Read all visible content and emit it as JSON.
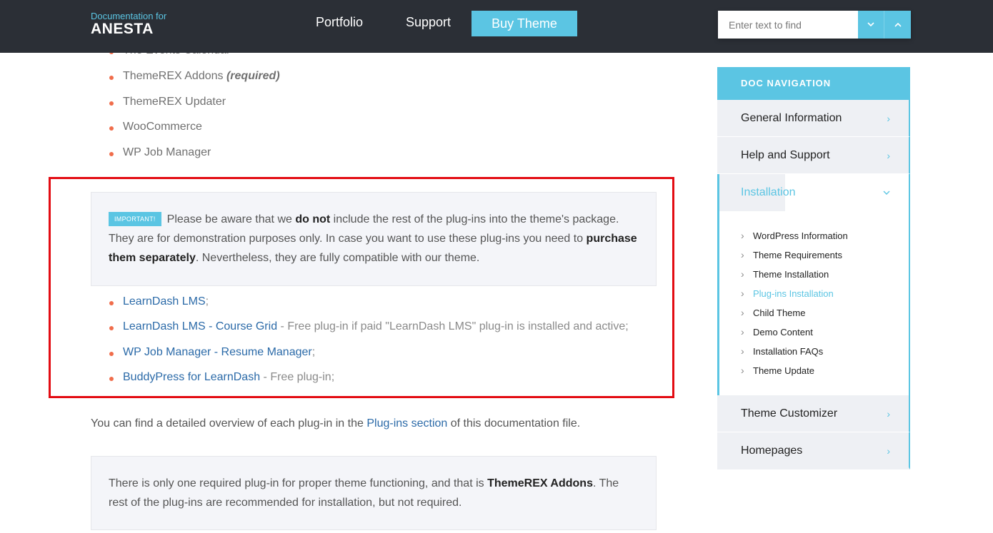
{
  "header": {
    "brand_small": "Documentation for",
    "brand_big": "ANESTA",
    "nav": [
      "Portfolio",
      "Support"
    ],
    "buy_label": "Buy Theme",
    "search_placeholder": "Enter text to find"
  },
  "content": {
    "top_list": [
      {
        "text": "The Events Calendar"
      },
      {
        "text": "ThemeREX Addons ",
        "em": "(required)"
      },
      {
        "text": "ThemeREX Updater"
      },
      {
        "text": "WooCommerce"
      },
      {
        "text": "WP Job Manager"
      }
    ],
    "notice": {
      "badge": "IMPORTANT!",
      "t1": "Please be aware that we ",
      "b1": "do not",
      "t2": " include the rest of the plug-ins into the theme's package. They are for demonstration purposes only. In case you want to use these plug-ins you need to ",
      "b2": "purchase them separately",
      "t3": ". Nevertheless, they are fully compatible with our theme."
    },
    "plugin_list": [
      {
        "link": "LearnDash LMS",
        "note": ";"
      },
      {
        "link": "LearnDash LMS - Course Grid",
        "note": " - Free plug-in if paid \"LearnDash LMS\" plug-in is installed and active;"
      },
      {
        "link": "WP Job Manager - Resume Manager",
        "note": ";"
      },
      {
        "link": "BuddyPress for LearnDash",
        "note": " - Free plug-in;"
      }
    ],
    "para": {
      "t1": "You can find a detailed overview of each plug-in in the ",
      "link": "Plug-ins section",
      "t2": " of this documentation file."
    },
    "notice2": {
      "t1": "There is only one required plug-in for proper theme functioning, and that is ",
      "b1": "ThemeREX Addons",
      "t2": ". The rest of the plug-ins are recommended for installation, but not required."
    }
  },
  "sidebar": {
    "title": "DOC NAVIGATION",
    "items_before": [
      "General Information",
      "Help and Support"
    ],
    "active": "Installation",
    "sub_items": [
      "WordPress Information",
      "Theme Requirements",
      "Theme Installation",
      "Plug-ins Installation",
      "Child Theme",
      "Demo Content",
      "Installation FAQs",
      "Theme Update"
    ],
    "current_sub": "Plug-ins Installation",
    "items_after": [
      "Theme Customizer",
      "Homepages"
    ]
  },
  "colors": {
    "header_bg": "#2b2f36",
    "accent": "#5bc5e3",
    "bullet": "#f06d4b",
    "link": "#2b6aa8",
    "highlight_box": "#e30c13"
  },
  "icons": {
    "search_prev": "chevron-down-icon",
    "search_next": "chevron-up-icon",
    "sidebar_arrow": "chevron-right-icon",
    "active_arrow": "chevron-down-icon"
  }
}
